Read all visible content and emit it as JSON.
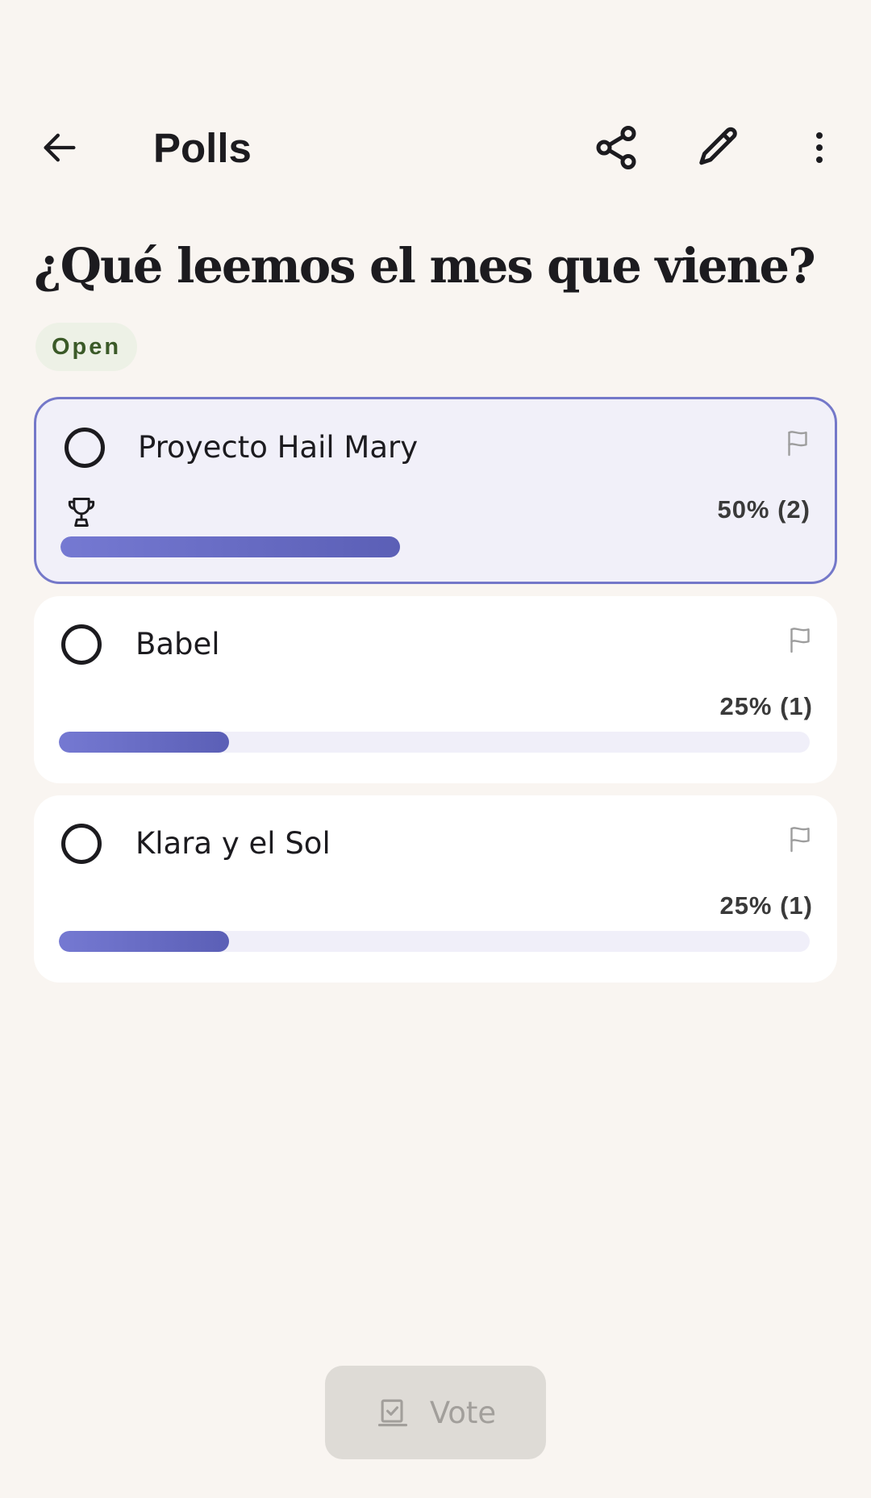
{
  "header": {
    "title": "Polls",
    "icons": {
      "back": "arrow-left-icon",
      "share": "share-icon",
      "edit": "pencil-icon",
      "more": "more-vertical-icon"
    }
  },
  "poll": {
    "question": "¿Qué leemos el mes que viene?",
    "status": "Open",
    "status_color": "#3b5a28",
    "options": [
      {
        "label": "Proyecto Hail Mary",
        "percent_label": "50% (2)",
        "percent": 50,
        "votes": 2,
        "winner": true
      },
      {
        "label": "Babel",
        "percent_label": "25% (1)",
        "percent": 25,
        "votes": 1,
        "winner": false
      },
      {
        "label": "Klara y el Sol",
        "percent_label": "25% (1)",
        "percent": 25,
        "votes": 1,
        "winner": false
      }
    ]
  },
  "footer": {
    "vote_label": "Vote",
    "vote_enabled": false,
    "vote_icon": "ballot-check-icon"
  },
  "colors": {
    "background": "#f9f5f1",
    "accent": "#6b6fc4",
    "winner_border": "#7478c9",
    "winner_background": "#f1f0f9"
  }
}
